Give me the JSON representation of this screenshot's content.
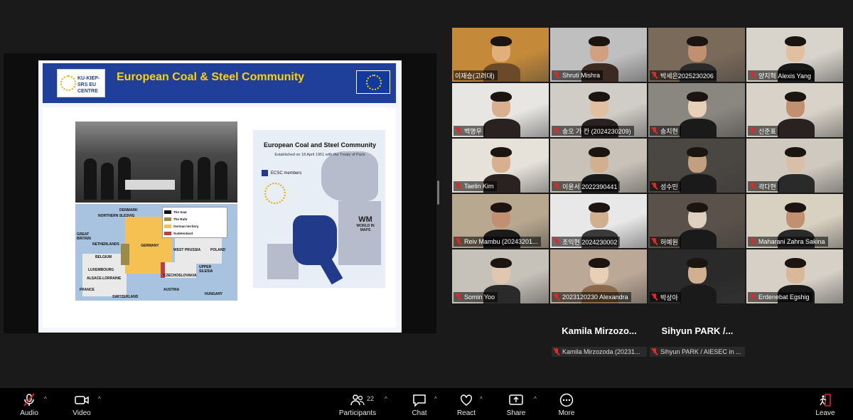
{
  "slide": {
    "title": "European Coal & Steel Community",
    "logo_text": "KU-KIEP-SRS EU CENTRE",
    "map_legend": [
      "The Saar",
      "The Ruhr",
      "German territory",
      "Sudetenland",
      "Rhineland (demilitarised zone)"
    ],
    "map_labels": {
      "denmark": "DENMARK",
      "northern_slesvig": "NORTHERN SLESVIG",
      "great_britain": "GREAT BRITAIN",
      "netherlands": "NETHERLANDS",
      "germany": "GERMANY",
      "west_prussia": "WEST PRUSSIA",
      "poland": "POLAND",
      "belgium": "BELGIUM",
      "luxembourg": "LUXEMBOURG",
      "upper_silesia": "UPPER SILESIA",
      "czechoslovakia": "CZECHOSLOVAKIA",
      "alsace_lorraine": "ALSACE-LORRAINE",
      "france": "FRANCE",
      "austria": "AUSTRIA",
      "hungary": "HUNGARY",
      "switzerland": "SWITZERLAND"
    },
    "ecsc_title": "European Coal and Steel Community",
    "ecsc_subtitle": "Established on 18 April 1951 with the Treaty of Paris",
    "ecsc_key": "ECSC members",
    "watermark_top": "WM",
    "watermark_bottom": "WORLD IN MAPS"
  },
  "participants": [
    {
      "name": "이재승(고려대)",
      "muted": false
    },
    {
      "name": "Shruti Mishra",
      "muted": true
    },
    {
      "name": "박세은2025230206",
      "muted": true
    },
    {
      "name": "양지혁 Alexis Yang",
      "muted": true
    },
    {
      "name": "백명우",
      "muted": true
    },
    {
      "name": "송오 가 칸 (2024230209)",
      "muted": true
    },
    {
      "name": "송지현",
      "muted": true
    },
    {
      "name": "신준표",
      "muted": true
    },
    {
      "name": "Taelin Kim",
      "muted": true
    },
    {
      "name": "이윤서 2022390441",
      "muted": true
    },
    {
      "name": "성수민",
      "muted": true
    },
    {
      "name": "곽다현",
      "muted": true
    },
    {
      "name": "Reiv Mambu (20243201...",
      "muted": true
    },
    {
      "name": "조익현 2024230002",
      "muted": true
    },
    {
      "name": "허예원",
      "muted": true
    },
    {
      "name": "Maharani Zahra Sakina",
      "muted": true
    },
    {
      "name": "Somin Yoo",
      "muted": true
    },
    {
      "name": "2023120230 Alexandra",
      "muted": true
    },
    {
      "name": "박상아",
      "muted": true
    },
    {
      "name": "Erdenebat Egshig",
      "muted": true
    }
  ],
  "extra_participants": [
    {
      "display": "Kamila  Mirzozo...",
      "plate": "Kamila Mirzozoda (20231..."
    },
    {
      "display": "Sihyun  PARK  /...",
      "plate": "Sihyun PARK / AIESEC in ..."
    }
  ],
  "toolbar": {
    "audio": "Audio",
    "video": "Video",
    "participants": "Participants",
    "participants_count": "22",
    "chat": "Chat",
    "react": "React",
    "share": "Share",
    "more": "More",
    "leave": "Leave"
  },
  "colors": {
    "active_speaker": "#2dd36f",
    "mute_red": "#e02828",
    "slide_header": "#1f3f9b",
    "slide_title": "#ffd200",
    "ecsc_members": "#213a8a",
    "leave_red": "#e02828"
  }
}
